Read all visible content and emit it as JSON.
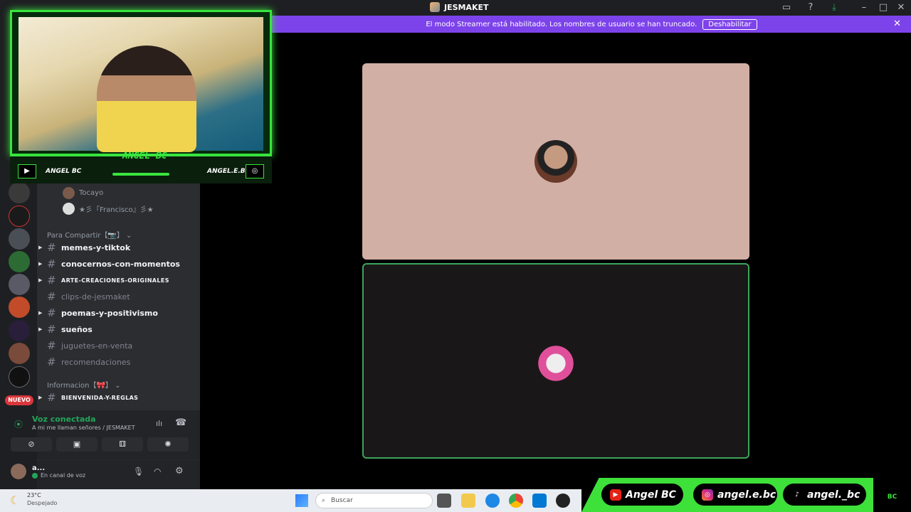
{
  "window": {
    "title": "JESMAKET"
  },
  "banner": {
    "message": "El modo Streamer está habilitado. Los nombres de usuario se han truncado.",
    "button_label": "Deshabilitar"
  },
  "voice_users": [
    {
      "name": "Tocayo"
    },
    {
      "name": "★彡『Francisco』彡★"
    }
  ],
  "categories": {
    "compartir": "Para Compartir【📷】",
    "informacion": "Informacion【🎀】"
  },
  "channels": [
    {
      "name": "memes-y-tiktok"
    },
    {
      "name": "conocernos-con-momentos"
    },
    {
      "name": "ARTE-CREACIONES-ORIGINALES"
    },
    {
      "name": "clips-de-jesmaket"
    },
    {
      "name": "poemas-y-positivismo"
    },
    {
      "name": "sueños"
    },
    {
      "name": "juguetes-en-venta"
    },
    {
      "name": "recomendaciones"
    },
    {
      "name": "BIENVENIDA-Y-REGLAS"
    }
  ],
  "badge": {
    "new": "NUEVO"
  },
  "voice": {
    "status": "Voz conectada",
    "location": "A mi me llaman señores / JESMAKET"
  },
  "user": {
    "name": "a...",
    "status": "En canal de voz"
  },
  "overlay": {
    "streamer_name": "ANGEL BC",
    "youtube_label": "ANGEL BC",
    "instagram_label": "ANGEL.E.BC"
  },
  "taskbar": {
    "temperature": "23°C",
    "weather": "Despejado",
    "search_placeholder": "Buscar"
  },
  "socials": {
    "youtube": "Angel BC",
    "instagram": "angel.e.bc",
    "tiktok": "angel._bc"
  },
  "brand_text": "BC",
  "colors": {
    "accent": "#39e43e",
    "streamer_banner": "#7d43ea",
    "voice_green": "#23a55a"
  }
}
